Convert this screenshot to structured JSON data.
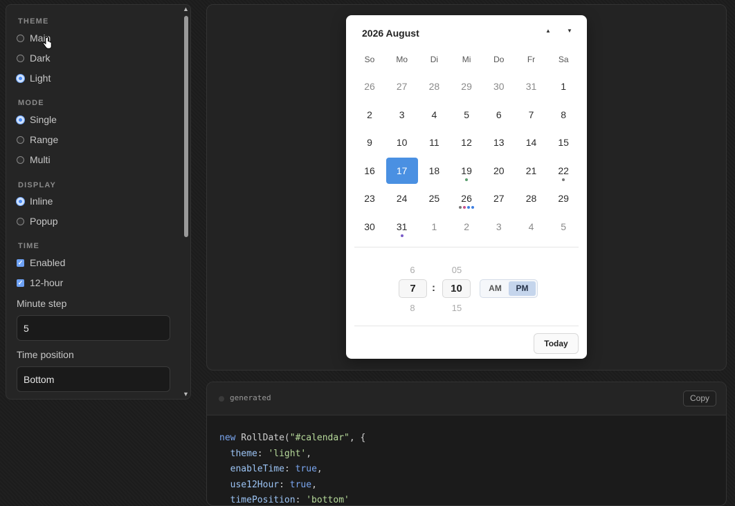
{
  "sidebar": {
    "sections": {
      "theme": "THEME",
      "mode": "MODE",
      "display": "DISPLAY",
      "time": "TIME"
    },
    "theme_options": [
      "Main",
      "Dark",
      "Light"
    ],
    "theme_selected": "Light",
    "mode_options": [
      "Single",
      "Range",
      "Multi"
    ],
    "mode_selected": "Single",
    "display_options": [
      "Inline",
      "Popup"
    ],
    "display_selected": "Inline",
    "time_checks": [
      "Enabled",
      "12-hour"
    ],
    "minute_step_label": "Minute step",
    "minute_step_value": "5",
    "time_position_label": "Time position",
    "time_position_value": "Bottom"
  },
  "calendar": {
    "title": "2026 August",
    "weekdays": [
      "So",
      "Mo",
      "Di",
      "Mi",
      "Do",
      "Fr",
      "Sa"
    ],
    "weeks": [
      [
        "26",
        "27",
        "28",
        "29",
        "30",
        "31",
        "1"
      ],
      [
        "2",
        "3",
        "4",
        "5",
        "6",
        "7",
        "8"
      ],
      [
        "9",
        "10",
        "11",
        "12",
        "13",
        "14",
        "15"
      ],
      [
        "16",
        "17",
        "18",
        "19",
        "20",
        "21",
        "22"
      ],
      [
        "23",
        "24",
        "25",
        "26",
        "27",
        "28",
        "29"
      ],
      [
        "30",
        "31",
        "1",
        "2",
        "3",
        "4",
        "5"
      ]
    ],
    "selected_day": "17",
    "time": {
      "hour_prev": "6",
      "hour": "7",
      "hour_next": "8",
      "minute_prev": "05",
      "minute": "10",
      "minute_next": "15",
      "separator": ":",
      "am_label": "AM",
      "pm_label": "PM",
      "period": "PM"
    },
    "today_label": "Today"
  },
  "code_panel": {
    "title": "generated",
    "copy_label": "Copy",
    "lines": [
      "new RollDate(\"#calendar\", {",
      "  theme: 'light',",
      "  enableTime: true,",
      "  use12Hour: true,",
      "  timePosition: 'bottom'"
    ]
  },
  "colors": {
    "accent": "#4a90e2",
    "event_green": "#5a9e6e",
    "event_gray": "#777777",
    "event_pink": "#c8508c",
    "event_blue": "#3f7fe0",
    "event_purple": "#7a5cc8"
  }
}
